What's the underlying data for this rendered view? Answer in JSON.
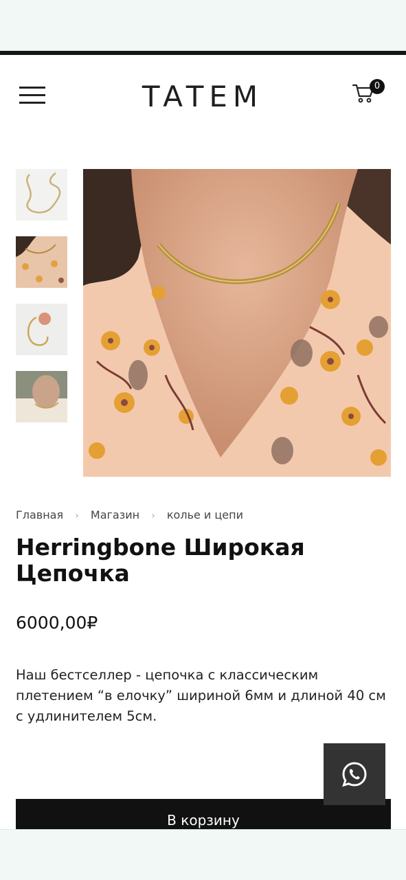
{
  "header": {
    "logo": "TATEM",
    "cart_count": "0"
  },
  "gallery": {
    "thumbnails": [
      "chain-on-white",
      "chain-on-model-floral",
      "chain-with-peach",
      "model-portrait"
    ],
    "main_image": "model-wearing-herringbone-chain"
  },
  "breadcrumb": [
    "Главная",
    "Магазин",
    "колье и цепи"
  ],
  "product": {
    "title": "Herringbone Широкая Цепочка",
    "price": "6000,00₽",
    "description": "Наш бестселлер - цепочка с классическим плетением “в елочку” шириной 6мм и длиной 40 см с удлинителем 5см.",
    "add_to_cart_label": "В корзину"
  },
  "icons": {
    "menu": "hamburger-icon",
    "cart": "shopping-cart-icon",
    "chat": "whatsapp-icon"
  },
  "colors": {
    "accent": "#111111",
    "chat_button": "#333333",
    "chrome": "#f1f8f6"
  }
}
